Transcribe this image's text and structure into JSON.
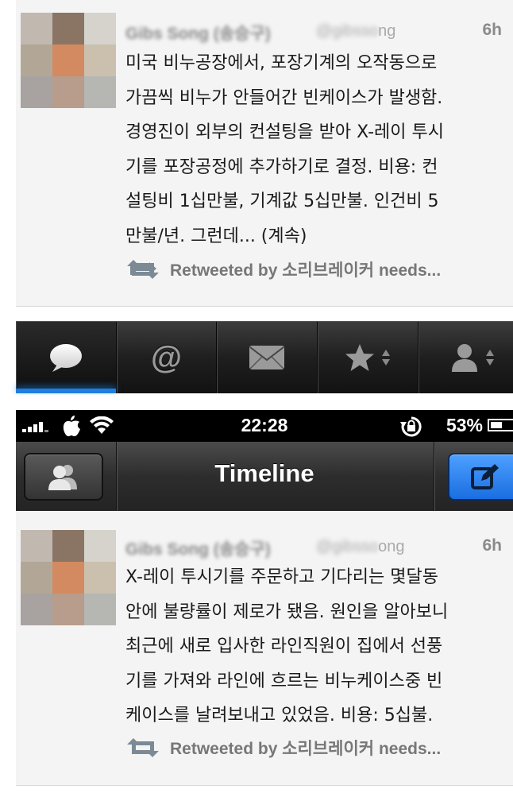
{
  "tweets": [
    {
      "author": "Gibs Song (송승구)",
      "handle_hidden": "@gibsso",
      "handle_visible": "ng",
      "time": "6h",
      "avatar_colors": [
        "#c1b8b0",
        "#8a7565",
        "#d5d3cc",
        "#b2a797",
        "#d48a60",
        "#cbbfae",
        "#a8a2a1",
        "#b89c8c",
        "#b6b6b3"
      ],
      "text": "미국 비누공장에서, 포장기계의 오작동으로\n가끔씩 비누가 안들어간 빈케이스가 발생함.\n경영진이 외부의 컨설팅을 받아 X-레이 투시\n기를 포장공정에 추가하기로 결정. 비용: 컨\n설팅비 1십만불, 기계값 5십만불. 인건비 5\n만불/년. 그런데... (계속)",
      "retweet_label": "Retweeted by 소리브레이커 needs..."
    },
    {
      "author": "Gibs Song (송승구)",
      "handle_hidden": "@gibsso",
      "handle_visible": "ong",
      "time": "6h",
      "avatar_colors": [
        "#c1b8b0",
        "#8a7565",
        "#d5d3cc",
        "#b2a797",
        "#d48a60",
        "#cbbfae",
        "#a8a2a1",
        "#b89c8c",
        "#b6b6b3"
      ],
      "text": "X-레이 투시기를 주문하고 기다리는 몇달동\n안에 불량률이 제로가 됐음. 원인을 알아보니\n최근에 새로 입사한 라인직원이 집에서 선풍\n기를 가져와 라인에 흐르는 비누케이스중 빈\n케이스를 날려보내고 있었음.  비용: 5십불.",
      "retweet_label": "Retweeted by 소리브레이커 needs..."
    }
  ],
  "tabbar": {
    "tabs": [
      {
        "icon": "speech-bubble-icon",
        "active": true
      },
      {
        "icon": "at-sign-icon",
        "glyph": "@"
      },
      {
        "icon": "envelope-icon"
      },
      {
        "icon": "star-icon",
        "has_switcher": true
      },
      {
        "icon": "person-icon",
        "has_switcher": true
      }
    ]
  },
  "statusbar": {
    "time": "22:28",
    "battery": "53%",
    "battery_level": 0.53
  },
  "navbar": {
    "title": "Timeline"
  },
  "colors": {
    "tab_active_accent": "#1e7fe0",
    "compose_button": "#1a6ee0",
    "tweet_background": "#f4f4f4"
  }
}
